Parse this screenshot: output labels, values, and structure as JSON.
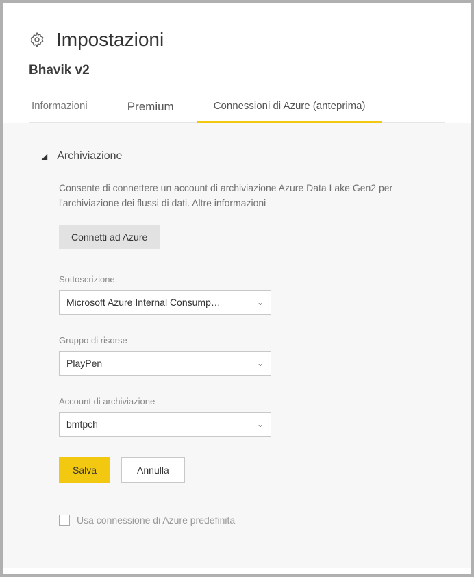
{
  "header": {
    "title": "Impostazioni",
    "subtitle": "Bhavik v2"
  },
  "tabs": {
    "info": "Informazioni",
    "premium": "Premium",
    "azure": "Connessioni di Azure (anteprima)"
  },
  "storage": {
    "section_title": "Archiviazione",
    "description_line1": "Consente di connettere un account di archiviazione Azure Data Lake Gen2 per",
    "description_line2": "l'archiviazione dei flussi di dati. ",
    "more_info": "Altre informazioni",
    "connect_button": "Connetti ad Azure",
    "subscription_label": "Sottoscrizione",
    "subscription_value": "Microsoft Azure Internal Consump…",
    "resource_group_label": "Gruppo di risorse",
    "resource_group_value": "PlayPen",
    "storage_account_label": "Account di archiviazione",
    "storage_account_value": "bmtpch",
    "save_button": "Salva",
    "cancel_button": "Annulla",
    "default_checkbox_label": "Usa connessione di Azure predefinita"
  }
}
